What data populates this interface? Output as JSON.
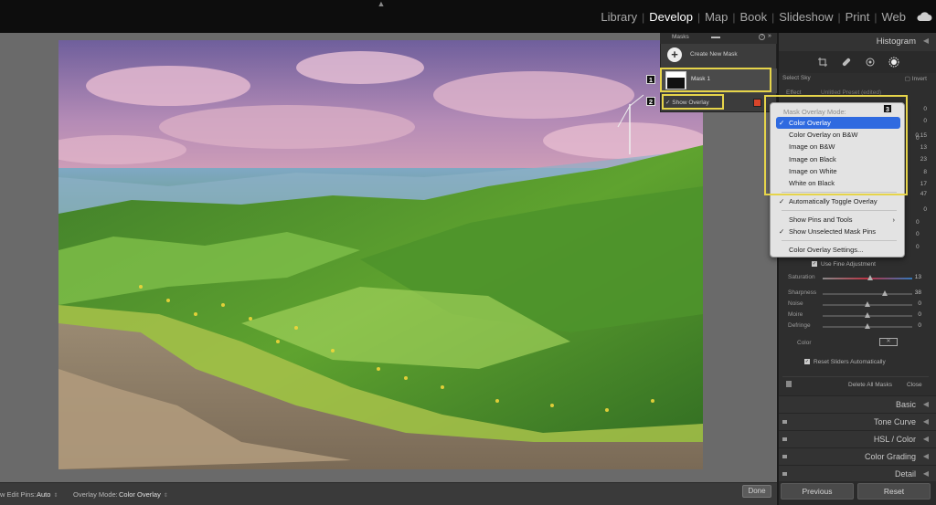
{
  "topbar": {
    "modules": [
      "Library",
      "Develop",
      "Map",
      "Book",
      "Slideshow",
      "Print",
      "Web"
    ],
    "active_module": "Develop"
  },
  "right_panel": {
    "histogram_label": "Histogram",
    "select_sky_label": "Select Sky",
    "invert_label": "Invert",
    "effect_label": "Effect",
    "effect_preset": "Unlitled Preset (edited)",
    "effect_values": [
      "0",
      "0",
      "0.15",
      "13",
      "23",
      "8",
      "17",
      "47",
      "0",
      "0",
      "0",
      "0",
      "0"
    ],
    "fine_adjustment_label": "Use Fine Adjustment",
    "sliders": [
      {
        "label": "Saturation",
        "value": "13",
        "level": 0.53
      },
      {
        "label": "Sharpness",
        "value": "38",
        "level": 0.69
      },
      {
        "label": "Noise",
        "value": "0",
        "level": 0.5
      },
      {
        "label": "Moire",
        "value": "0",
        "level": 0.5
      },
      {
        "label": "Defringe",
        "value": "0",
        "level": 0.5
      }
    ],
    "color_label": "Color",
    "reset_sliders_label": "Reset Sliders Automatically",
    "delete_all_masks_label": "Delete All Masks",
    "close_label": "Close",
    "sections": [
      "Basic",
      "Tone Curve",
      "HSL / Color",
      "Color Grading",
      "Detail"
    ],
    "previous_label": "Previous",
    "reset_label": "Reset"
  },
  "masks_panel": {
    "title": "Masks",
    "create_new_mask_label": "Create New Mask",
    "mask_name": "Mask 1",
    "show_overlay_label": "Show Overlay",
    "overlay_color": "#d9452a"
  },
  "highlights": {
    "labels": [
      "1",
      "2",
      "3"
    ],
    "color": "#e6d44a"
  },
  "menu": {
    "header": "Mask Overlay Mode:",
    "modes": [
      "Color Overlay",
      "Color Overlay on B&W",
      "Image on B&W",
      "Image on Black",
      "Image on White",
      "White on Black"
    ],
    "selected_mode": "Color Overlay",
    "auto_toggle_label": "Automatically Toggle Overlay",
    "show_pins_tools_label": "Show Pins and Tools",
    "show_unselected_pins_label": "Show Unselected Mask Pins",
    "overlay_settings_label": "Color Overlay Settings...",
    "selected_color": "#2f6ae0"
  },
  "toolbar": {
    "edit_pins_label": "w Edit Pins:",
    "edit_pins_value": "Auto",
    "overlay_mode_label": "Overlay Mode:",
    "overlay_mode_value": "Color Overlay",
    "done_label": "Done"
  }
}
